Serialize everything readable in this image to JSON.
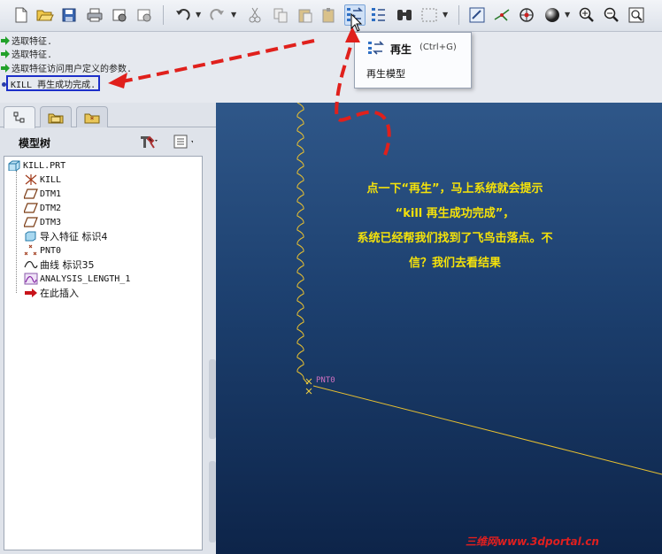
{
  "toolbar": {
    "buttons": [
      {
        "name": "new-icon"
      },
      {
        "name": "open-icon"
      },
      {
        "name": "save-icon"
      },
      {
        "name": "print-icon"
      },
      {
        "name": "send-email-icon"
      },
      {
        "name": "email-link-icon"
      },
      {
        "name": "undo-icon"
      },
      {
        "name": "redo-icon"
      },
      {
        "name": "cut-icon"
      },
      {
        "name": "copy-icon"
      },
      {
        "name": "paste-icon"
      },
      {
        "name": "paste-special-icon"
      },
      {
        "name": "regenerate-icon"
      },
      {
        "name": "regenerate-manager-icon"
      },
      {
        "name": "find-icon"
      },
      {
        "name": "select-box-icon"
      },
      {
        "name": "repaint-icon"
      },
      {
        "name": "spin-center-icon"
      },
      {
        "name": "view-manager-icon"
      },
      {
        "name": "shading-icon"
      },
      {
        "name": "zoom-in-icon"
      },
      {
        "name": "zoom-out-icon"
      },
      {
        "name": "refit-icon"
      }
    ]
  },
  "messages": [
    {
      "text": "选取特征."
    },
    {
      "text": "选取特征."
    },
    {
      "text": "选取特征访问用户定义的参数."
    },
    {
      "text": "KILL 再生成功完成."
    }
  ],
  "tooltip": {
    "title": "再生",
    "shortcut": "(Ctrl+G)",
    "description": "再生模型"
  },
  "model_tree": {
    "title": "模型树",
    "items": [
      {
        "label": "KILL.PRT",
        "icon": "part-icon"
      },
      {
        "label": "KILL",
        "icon": "coordinate-system-icon"
      },
      {
        "label": "DTM1",
        "icon": "datum-plane-icon"
      },
      {
        "label": "DTM2",
        "icon": "datum-plane-icon"
      },
      {
        "label": "DTM3",
        "icon": "datum-plane-icon"
      },
      {
        "label": "导入特征 标识4",
        "icon": "import-feature-icon"
      },
      {
        "label": "PNT0",
        "icon": "datum-point-icon"
      },
      {
        "label": "曲线 标识35",
        "icon": "curve-icon"
      },
      {
        "label": "ANALYSIS_LENGTH_1",
        "icon": "analysis-icon"
      },
      {
        "label": "在此插入",
        "icon": "insert-here-arrow-icon"
      }
    ]
  },
  "graphics": {
    "annotation_lines": [
      "点一下“再生”，马上系统就会提示",
      "“kill 再生成功完成”，",
      "系统已经帮我们找到了飞鸟击落点。不",
      "信？我们去看结果"
    ],
    "point_label": "PNT0",
    "watermark": "三维网www.3dportal.cn"
  },
  "colors": {
    "annotation": "#f5e20a",
    "callout_arrow": "#e0201c",
    "highlight_box": "#1d2fc9",
    "curve": "#e8c030",
    "background_top": "#2f5789",
    "background_bottom": "#0d2449"
  }
}
